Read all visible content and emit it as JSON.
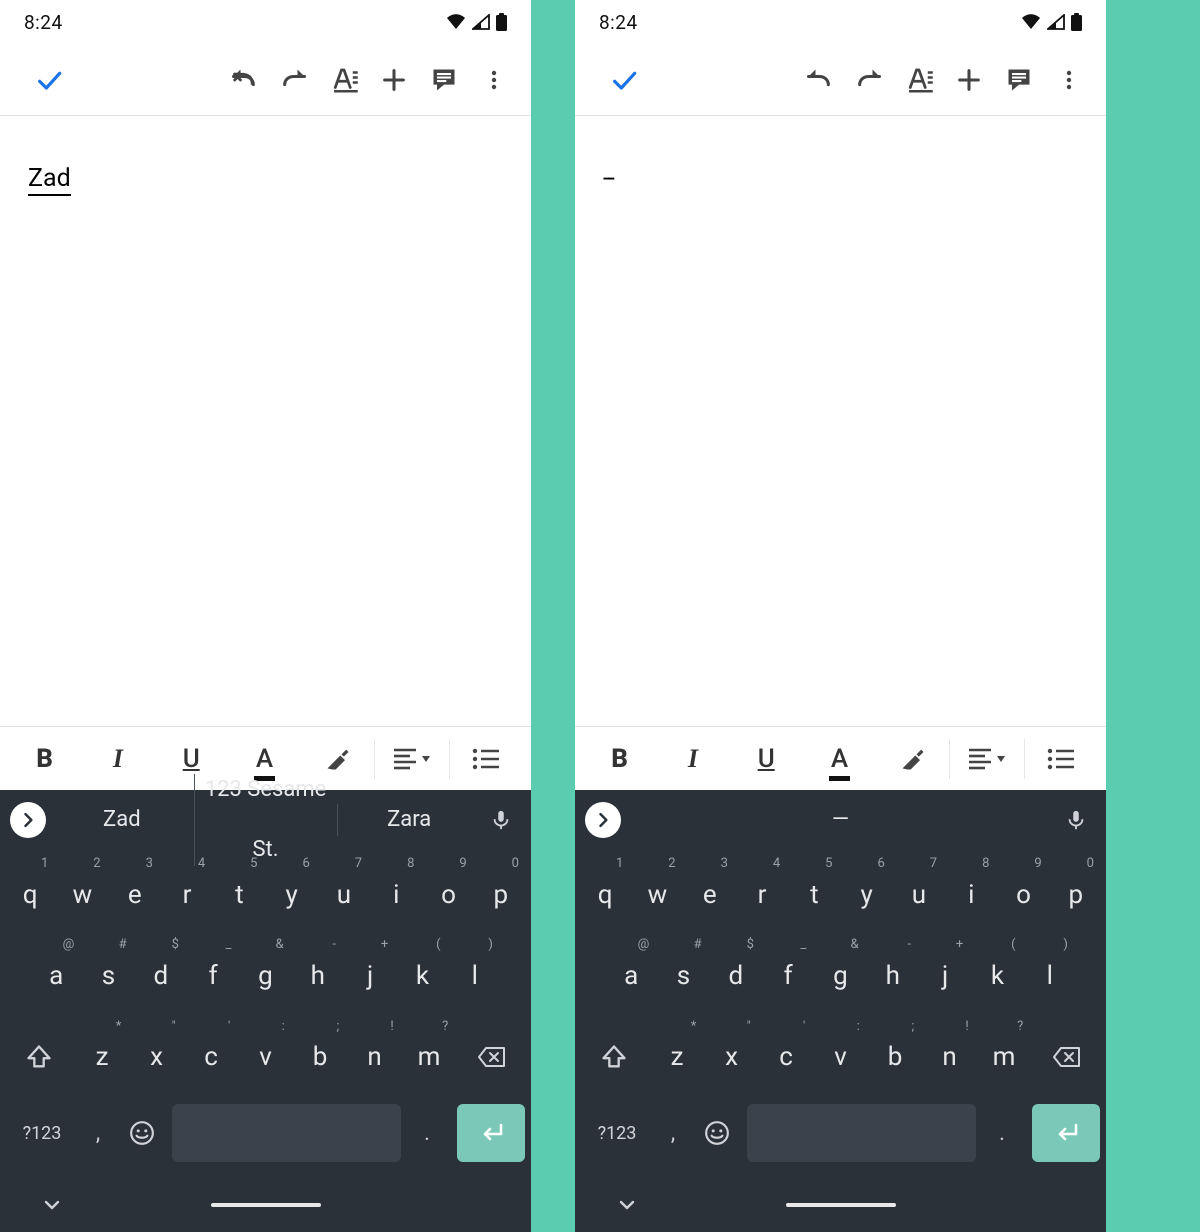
{
  "statusbar": {
    "time": "8:24"
  },
  "toolbar": {
    "check": "done",
    "undo": "undo",
    "redo": "redo",
    "format": "text-format",
    "insert": "insert",
    "comment": "comment",
    "overflow": "overflow"
  },
  "documents": {
    "left_text": "Zad",
    "right_text": "--"
  },
  "fmtbar": {
    "bold": "B",
    "italic": "I",
    "underline": "U",
    "textcolor": "A",
    "highlight_icon": "highlight",
    "align_icon": "align",
    "list_icon": "list"
  },
  "suggestions": {
    "left": [
      "Zad",
      "123 Sesame St.",
      "Zara"
    ],
    "right_single": "—"
  },
  "keyboard": {
    "row1": [
      {
        "k": "q",
        "h": "1"
      },
      {
        "k": "w",
        "h": "2"
      },
      {
        "k": "e",
        "h": "3"
      },
      {
        "k": "r",
        "h": "4"
      },
      {
        "k": "t",
        "h": "5"
      },
      {
        "k": "y",
        "h": "6"
      },
      {
        "k": "u",
        "h": "7"
      },
      {
        "k": "i",
        "h": "8"
      },
      {
        "k": "o",
        "h": "9"
      },
      {
        "k": "p",
        "h": "0"
      }
    ],
    "row2": [
      {
        "k": "a",
        "h": "@"
      },
      {
        "k": "s",
        "h": "#"
      },
      {
        "k": "d",
        "h": "$"
      },
      {
        "k": "f",
        "h": "_"
      },
      {
        "k": "g",
        "h": "&"
      },
      {
        "k": "h",
        "h": "-"
      },
      {
        "k": "j",
        "h": "+"
      },
      {
        "k": "k",
        "h": "("
      },
      {
        "k": "l",
        "h": ")"
      }
    ],
    "row3": [
      {
        "k": "z",
        "h": "*"
      },
      {
        "k": "x",
        "h": "\""
      },
      {
        "k": "c",
        "h": "'"
      },
      {
        "k": "v",
        "h": ":"
      },
      {
        "k": "b",
        "h": ";"
      },
      {
        "k": "n",
        "h": "!"
      },
      {
        "k": "m",
        "h": "?"
      }
    ],
    "modes": "?123",
    "comma": ",",
    "period": "."
  }
}
